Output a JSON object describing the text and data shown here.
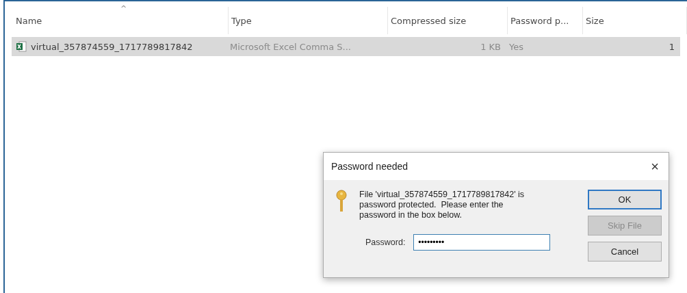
{
  "file_list": {
    "columns": [
      {
        "label": "Name",
        "sorted": true
      },
      {
        "label": "Type",
        "sorted": false
      },
      {
        "label": "Compressed size",
        "sorted": false
      },
      {
        "label": "Password p...",
        "sorted": false
      },
      {
        "label": "Size",
        "sorted": false
      }
    ],
    "sort_glyph": "^",
    "rows": [
      {
        "selected": true,
        "cells": [
          "virtual_357874559_1717789817842",
          "Microsoft Excel Comma S...",
          "1 KB",
          "Yes",
          "1"
        ]
      }
    ]
  },
  "dialog": {
    "title": "Password needed",
    "close": "×",
    "message": "File 'virtual_357874559_1717789817842' is password protected.  Please enter the password in the box below.",
    "field_label": "Password:",
    "field_value": "•••••••••",
    "buttons": [
      {
        "label": "OK",
        "default": true,
        "disabled": false
      },
      {
        "label": "Skip File",
        "default": false,
        "disabled": true
      },
      {
        "label": "Cancel",
        "default": false,
        "disabled": false
      }
    ]
  }
}
